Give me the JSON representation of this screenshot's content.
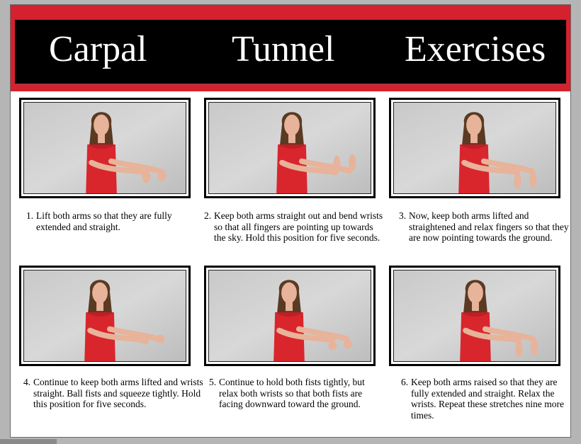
{
  "title": {
    "word1": "Carpal",
    "word2": "Tunnel",
    "word3": "Exercises"
  },
  "colors": {
    "banner_red": "#d5212e",
    "banner_black": "#000000"
  },
  "exercises": [
    {
      "number": "1.",
      "text": "Lift both arms so that they are fully extended and straight.",
      "pose": "arms-forward-hands-down"
    },
    {
      "number": "2.",
      "text": "Keep both arms straight out and bend wrists so that all fingers are pointing up towards the sky. Hold this position for five seconds.",
      "pose": "wrists-bent-up"
    },
    {
      "number": "3.",
      "text": "Now, keep both arms lifted and straightened and relax fingers so that they are now pointing towards the ground.",
      "pose": "fingers-down"
    },
    {
      "number": "4.",
      "text": "Continue to keep both arms lifted and wrists straight. Ball fists and squeeze tightly. Hold this position for five seconds.",
      "pose": "fists-straight"
    },
    {
      "number": "5.",
      "text": "Continue to hold both fists tightly, but relax both wrists so that both fists are facing downward toward the ground.",
      "pose": "fists-down"
    },
    {
      "number": "6.",
      "text": "Keep both arms raised so that they are fully extended and straight. Relax the wrists. Repeat these stretches nine more times.",
      "pose": "relaxed-wrists"
    }
  ]
}
